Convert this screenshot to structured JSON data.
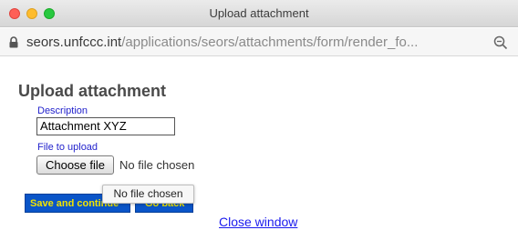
{
  "window": {
    "title": "Upload attachment"
  },
  "address_bar": {
    "host": "seors.unfccc.int",
    "path": "/applications/seors/attachments/form/render_fo...",
    "icons": [
      "lock-icon",
      "zoom-icon"
    ]
  },
  "form": {
    "heading": "Upload attachment",
    "description_label": "Description",
    "description_value": "Attachment XYZ",
    "file_label": "File to upload",
    "choose_file_button": "Choose file",
    "no_file_text": "No file chosen",
    "tooltip_text": "No file chosen",
    "save_button": "Save and continue",
    "goback_button": "Go back",
    "close_link": "Close window"
  },
  "colors": {
    "button_bg": "#0a55c8",
    "button_text": "#f2e400",
    "label_color": "#2222cc",
    "link_color": "#1a1aee"
  }
}
